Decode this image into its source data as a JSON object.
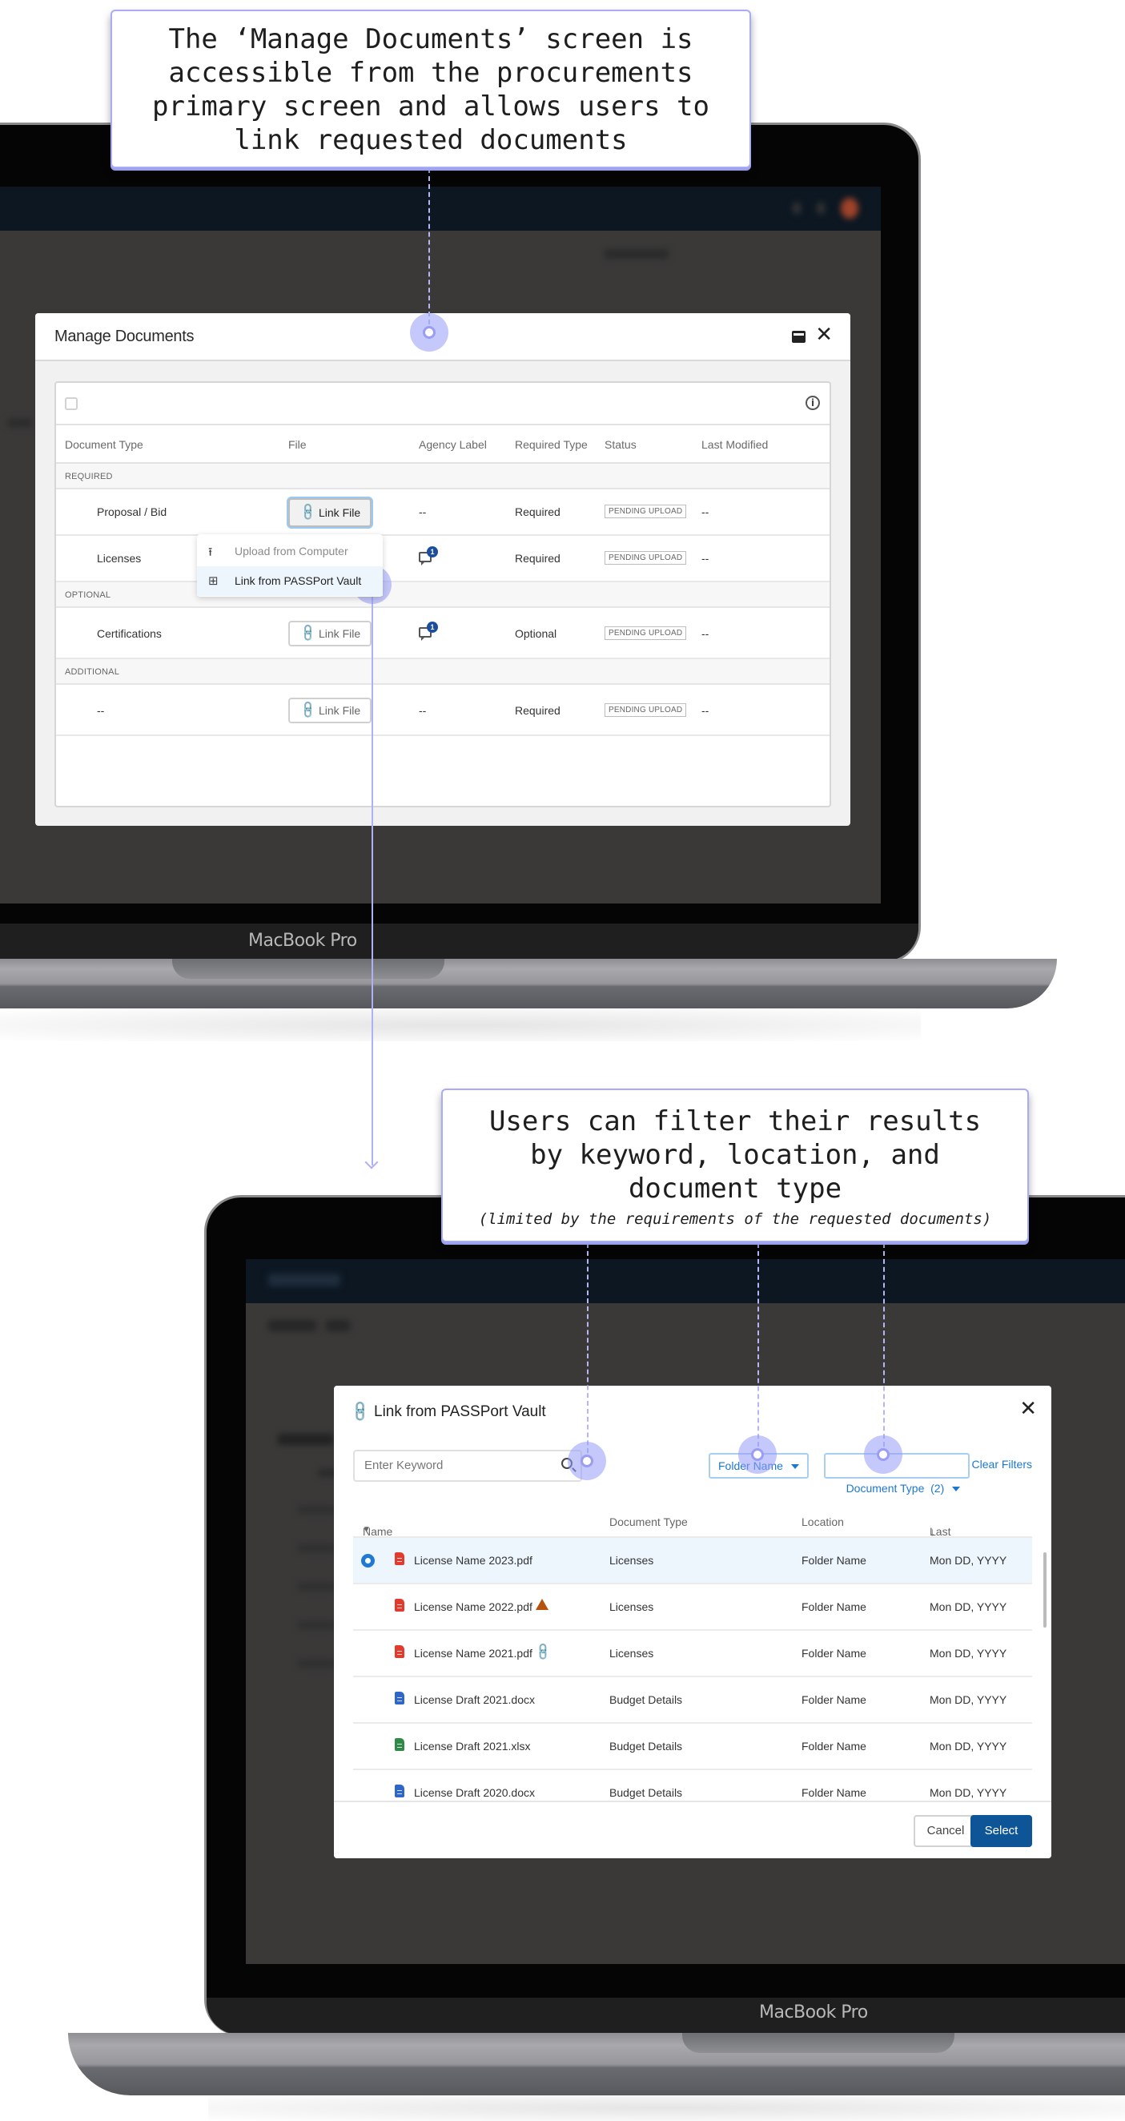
{
  "callouts": {
    "top": {
      "text": "The ‘Manage Documents’ screen is accessible from the procurements primary screen and allows users to link requested documents"
    },
    "bottom": {
      "text": "Users can filter their results by keyword, location, and document type",
      "subtext": "(limited by the requirements of the requested documents)"
    }
  },
  "laptop": {
    "brand_label": "MacBook Pro"
  },
  "manage_documents": {
    "title": "Manage Documents",
    "minimize_icon": "minimize-icon",
    "close_icon": "close-icon",
    "info_icon_glyph": "i",
    "columns": [
      "Document Type",
      "File",
      "Agency Label",
      "Required Type",
      "Status",
      "Last Modified"
    ],
    "sections": [
      {
        "label": "REQUIRED",
        "rows": [
          {
            "document_type": "Proposal / Bid",
            "file_button": "Link File",
            "agency_label": "--",
            "required_type": "Required",
            "status": "PENDING UPLOAD",
            "last_modified": "--",
            "focused": true
          },
          {
            "document_type": "Licenses",
            "file_button": "",
            "agency_label_badge": "1",
            "required_type": "Required",
            "status": "PENDING UPLOAD",
            "last_modified": "--"
          }
        ]
      },
      {
        "label": "OPTIONAL",
        "rows": [
          {
            "document_type": "Certifications",
            "file_button": "Link File",
            "agency_label_badge": "1",
            "required_type": "Optional",
            "status": "PENDING UPLOAD",
            "last_modified": "--"
          }
        ]
      },
      {
        "label": "ADDITIONAL",
        "rows": [
          {
            "document_type": "--",
            "file_button": "Link File",
            "agency_label": "--",
            "required_type": "Required",
            "status": "PENDING UPLOAD",
            "last_modified": "--"
          }
        ]
      }
    ],
    "dropdown": {
      "items": [
        {
          "label": "Upload from Computer",
          "icon": "upload-icon",
          "glyph": "⭱"
        },
        {
          "label": "Link from PASSPort Vault",
          "icon": "grid-add-icon",
          "glyph": "⊞",
          "highlighted": true
        }
      ]
    }
  },
  "link_vault": {
    "title": "Link from PASSPort Vault",
    "title_icon_glyph": "🔗",
    "close_glyph": "✕",
    "search": {
      "placeholder": "Enter Keyword",
      "value": ""
    },
    "filters": [
      {
        "label": "Folder Name"
      },
      {
        "label": "Document Type  (2)"
      }
    ],
    "clear_filters_label": "Clear Filters",
    "columns": [
      {
        "label": "Name",
        "sort": "caret-down"
      },
      {
        "label": "Document Type"
      },
      {
        "label": "Location"
      },
      {
        "label": "Last Modified",
        "sort": "arrow-down"
      }
    ],
    "rows": [
      {
        "name": "License Name 2023.pdf",
        "file_type": "pdf",
        "document_type": "Licenses",
        "location": "Folder Name",
        "last_modified": "Mon DD, YYYY",
        "selected": true
      },
      {
        "name": "License Name 2022.pdf",
        "file_type": "pdf",
        "document_type": "Licenses",
        "location": "Folder Name",
        "last_modified": "Mon DD, YYYY",
        "flag": "warning"
      },
      {
        "name": "License Name 2021.pdf",
        "file_type": "pdf",
        "document_type": "Licenses",
        "location": "Folder Name",
        "last_modified": "Mon DD, YYYY",
        "flag": "linked"
      },
      {
        "name": "License Draft 2021.docx",
        "file_type": "docx",
        "document_type": "Budget Details",
        "location": "Folder Name",
        "last_modified": "Mon DD, YYYY"
      },
      {
        "name": "License Draft 2021.xlsx",
        "file_type": "xlsx",
        "document_type": "Budget Details",
        "location": "Folder Name",
        "last_modified": "Mon DD, YYYY"
      },
      {
        "name": "License Draft 2020.docx",
        "file_type": "docx",
        "document_type": "Budget Details",
        "location": "Folder Name",
        "last_modified": "Mon DD, YYYY"
      }
    ],
    "footer": {
      "cancel_label": "Cancel",
      "select_label": "Select"
    }
  },
  "colors": {
    "accent_blue": "#1b78d2",
    "primary_button": "#0d5596",
    "badge_blue": "#1d4e9e",
    "callout_border": "#a8abf5",
    "pdf_red": "#e23b2e",
    "docx_blue": "#2f66c9",
    "xlsx_green": "#2f8a47",
    "warning_orange": "#b5520d"
  }
}
